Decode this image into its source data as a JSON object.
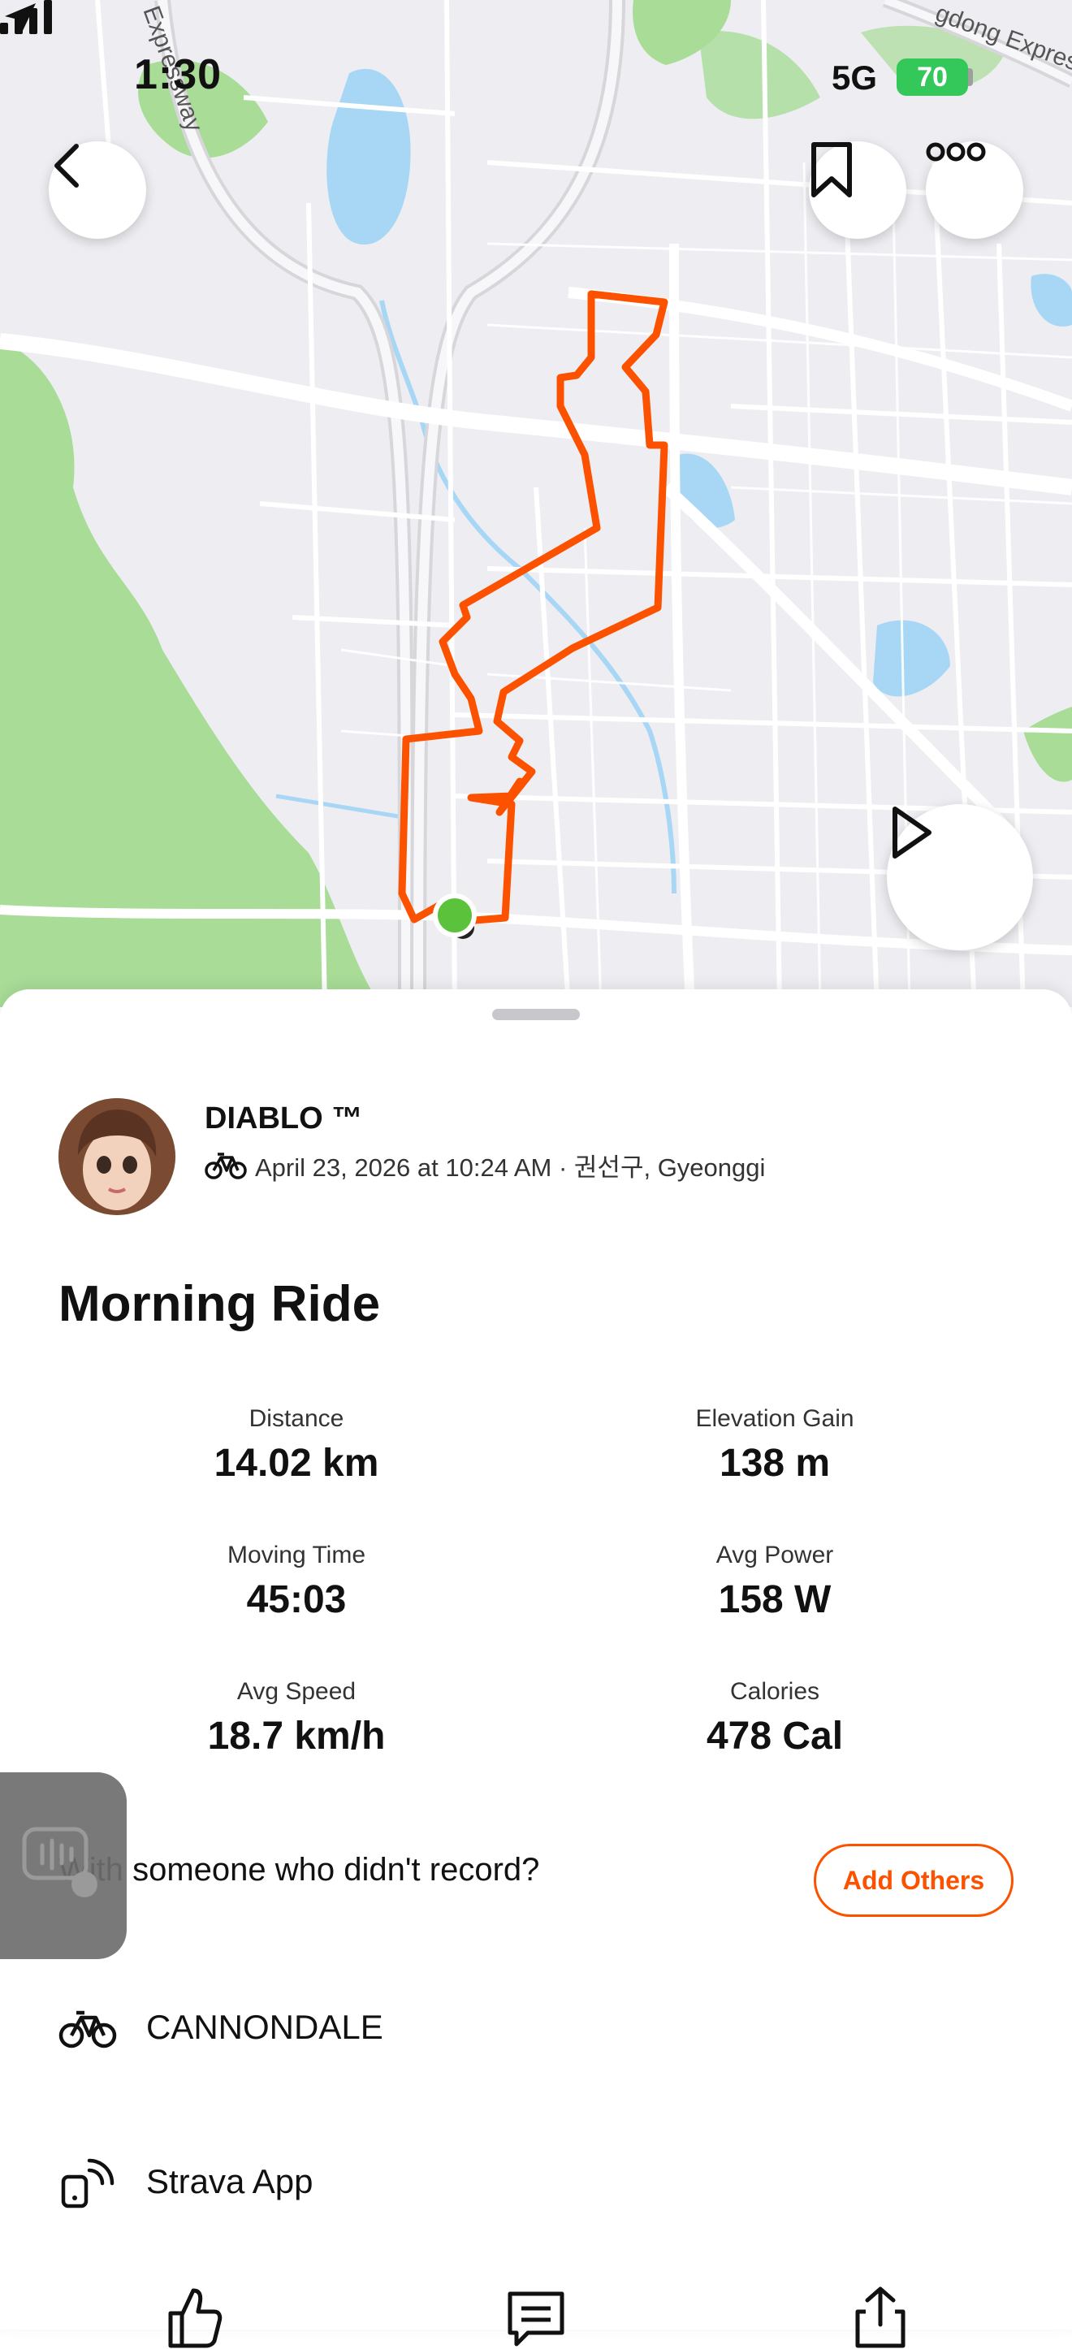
{
  "status_bar": {
    "time": "1:30",
    "network": "5G",
    "battery": "70"
  },
  "map": {
    "road_labels": [
      "Expressway",
      "gdong Expressv"
    ],
    "route_color": "#fc5200",
    "start_marker_color": "#5bc33b"
  },
  "activity": {
    "athlete_name": "DIABLO ™",
    "date_location": "April 23, 2026 at 10:24 AM · 권선구, Gyeonggi",
    "title": "Morning Ride"
  },
  "stats": [
    {
      "label": "Distance",
      "value": "14.02 km"
    },
    {
      "label": "Elevation Gain",
      "value": "138 m"
    },
    {
      "label": "Moving Time",
      "value": "45:03"
    },
    {
      "label": "Avg Power",
      "value": "158 W"
    },
    {
      "label": "Avg Speed",
      "value": "18.7 km/h"
    },
    {
      "label": "Calories",
      "value": "478 Cal"
    }
  ],
  "tagging": {
    "prompt": "With someone who didn't record?",
    "button": "Add Others"
  },
  "details": {
    "gear": "CANNONDALE",
    "device": "Strava App"
  },
  "colors": {
    "accent": "#fc5200",
    "map_background": "#eeeef2",
    "park": "#a8dc97",
    "water": "#a7d7f5"
  }
}
